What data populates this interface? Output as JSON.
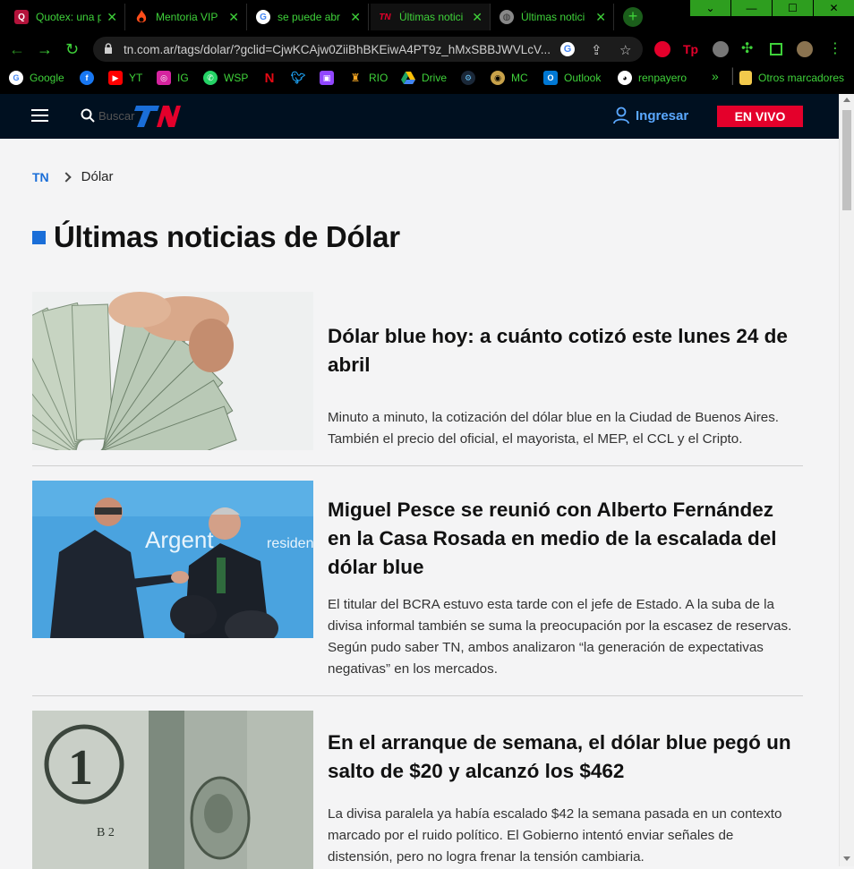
{
  "browser": {
    "tabs": [
      {
        "title": "Quotex: una p",
        "icon": "quotex-icon"
      },
      {
        "title": "Mentoria VIP",
        "icon": "fire-icon"
      },
      {
        "title": "se puede abr",
        "icon": "google-icon"
      },
      {
        "title": "Últimas notici",
        "icon": "tn-icon"
      },
      {
        "title": "Últimas notici",
        "icon": "globe-icon"
      }
    ],
    "url": "tn.com.ar/tags/dolar/?gclid=CjwKCAjw0ZiiBhBKEiwA4PT9z_hMxSBBJWVLcV...",
    "bookmarks": [
      {
        "label": "Google",
        "icon": "google-icon",
        "color": "#ffffff"
      },
      {
        "label": "",
        "icon": "facebook-icon",
        "color": "#1877f2"
      },
      {
        "label": "YT",
        "icon": "youtube-icon",
        "color": "#ff0000"
      },
      {
        "label": "IG",
        "icon": "instagram-icon",
        "color": "#d6249f"
      },
      {
        "label": "WSP",
        "icon": "whatsapp-icon",
        "color": "#25d366"
      },
      {
        "label": "",
        "icon": "netflix-icon",
        "color": "#e50914"
      },
      {
        "label": "",
        "icon": "twitter-icon",
        "color": "#1da1f2"
      },
      {
        "label": "",
        "icon": "twitch-icon",
        "color": "#9146ff"
      },
      {
        "label": "RIO",
        "icon": "rio-icon",
        "color": "#f5a623"
      },
      {
        "label": "Drive",
        "icon": "drive-icon",
        "color": "#1fa463"
      },
      {
        "label": "",
        "icon": "steam-icon",
        "color": "#66c0f4"
      },
      {
        "label": "MC",
        "icon": "mc-icon",
        "color": "#c8a24a"
      },
      {
        "label": "Outlook",
        "icon": "outlook-icon",
        "color": "#0078d4"
      },
      {
        "label": "renpayero",
        "icon": "github-icon",
        "color": "#ffffff"
      }
    ],
    "more": "»",
    "other_bookmarks": "Otros marcadores"
  },
  "header": {
    "logo": "TN",
    "search_placeholder": "Buscar",
    "login": "Ingresar",
    "live": "EN VIVO"
  },
  "breadcrumb": {
    "home": "TN",
    "current": "Dólar"
  },
  "page_title": "Últimas noticias de Dólar",
  "articles": [
    {
      "title": "Dólar blue hoy: a cuánto cotizó este lunes 24 de abril",
      "summary": "Minuto a minuto, la cotización del dólar blue en la Ciudad de Buenos Aires. También el precio del oficial, el mayorista, el MEP, el CCL y el Cripto."
    },
    {
      "title": "Miguel Pesce se reunió con Alberto Fernández en la Casa Rosada en medio de la escalada del dólar blue",
      "summary": "El titular del BCRA estuvo esta tarde con el jefe de Estado. A la suba de la divisa informal también se suma la preocupación por la escasez de reservas. Según pudo saber TN, ambos analizaron “la generación de expectativas negativas” en los mercados.",
      "image_text": "Argent",
      "image_text2": "residen"
    },
    {
      "title": "En el arranque de semana, el dólar blue pegó un salto de $20 y alcanzó los $462",
      "summary": "La divisa paralela ya había escalado $42 la semana pasada en un contexto marcado por el ruido político. El Gobierno intentó enviar señales de distensión, pero no logra frenar la tensión cambiaria."
    }
  ],
  "colors": {
    "accent": "#1a6ed8",
    "header_bg": "#001020",
    "live": "#e4002b",
    "chrome_green": "#3fd23a"
  }
}
